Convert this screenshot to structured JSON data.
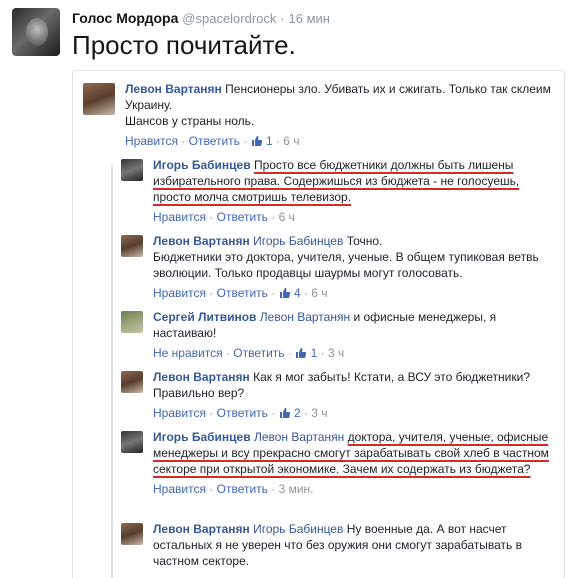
{
  "tweet": {
    "name": "Голос Мордора",
    "handle": "@spacelordrock",
    "dot": "·",
    "time": "16 мин",
    "text": "Просто почитайте."
  },
  "comments": [
    {
      "author": "Левон Вартанян",
      "tag": "",
      "lines": [
        "Пенсионеры зло. Убивать их и сжигать. Только так склеим Украину.",
        "Шансов у страны ноль."
      ],
      "actions": {
        "like": "Нравится",
        "reply": "Ответить",
        "likes": "1",
        "time": "6 ч"
      }
    },
    {
      "author": "Игорь Бабинцев",
      "tag": "",
      "text": "Просто все бюджетники должны быть лишены избирательного права. Содержишься из бюджета - не голосуешь, просто молча смотришь телевизор.",
      "actions": {
        "like": "Нравится",
        "reply": "Ответить",
        "likes": "",
        "time": "6 ч"
      }
    },
    {
      "author": "Левон Вартанян",
      "tag": "Игорь Бабинцев",
      "lines": [
        "Точно.",
        "Бюджетники это доктора, учителя, ученые. В общем тупиковая ветвь эволюции. Только продавцы шаурмы могут голосовать."
      ],
      "actions": {
        "like": "Нравится",
        "reply": "Ответить",
        "likes": "4",
        "time": "6 ч"
      }
    },
    {
      "author": "Сергей Литвинов",
      "tag": "Левон Вартанян",
      "text": "и офисные менеджеры, я настаиваю!",
      "actions": {
        "like": "Не нравится",
        "reply": "Ответить",
        "likes": "1",
        "time": "3 ч"
      }
    },
    {
      "author": "Левон Вартанян",
      "tag": "",
      "text": "Как я мог забыть! Кстати, а ВСУ это бюджетники? Правильно вер?",
      "actions": {
        "like": "Нравится",
        "reply": "Ответить",
        "likes": "2",
        "time": "3 ч"
      }
    },
    {
      "author": "Игорь Бабинцев",
      "tag": "Левон Вартанян",
      "text": "доктора, учителя, ученые, офисные менеджеры и всу прекрасно смогут зарабатывать свой хлеб в частном секторе при открытой экономике. Зачем их содержать из бюджета?",
      "actions": {
        "like": "Нравится",
        "reply": "Ответить",
        "likes": "",
        "time": "3 мин."
      }
    },
    {
      "author": "Левон Вартанян",
      "tag": "Игорь Бабинцев",
      "text": "Ну военные да. А вот насчет остальных я не уверен что без оружия они смогут зарабатывать в частном секторе.",
      "actions": {}
    }
  ],
  "separator": " · "
}
